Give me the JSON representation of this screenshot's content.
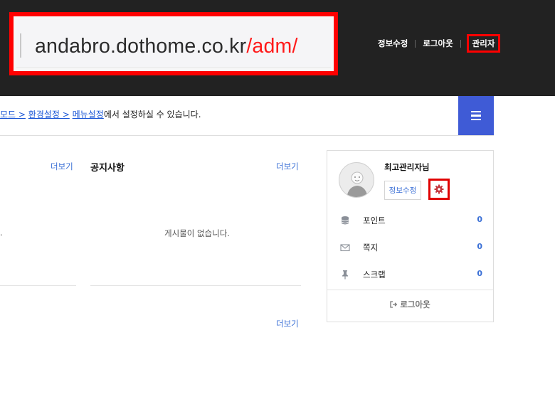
{
  "url_bar": {
    "domain": "andabro.dothome.co.kr",
    "path": "/adm/"
  },
  "top_nav": {
    "edit_info": "정보수정",
    "logout": "로그아웃",
    "admin": "관리자"
  },
  "info_line": {
    "link1": "모드 >",
    "link2": "환경설정 >",
    "link3": "메뉴설정",
    "suffix": "에서 설정하실 수 있습니다."
  },
  "boards": {
    "left_more": "더보기",
    "notice_title": "공지사항",
    "notice_more": "더보기",
    "notice_empty": "게시물이 없습니다.",
    "left_fragment": ".",
    "bottom_more": "더보기"
  },
  "profile": {
    "name": "최고관리자님",
    "edit_button": "정보수정",
    "stats": [
      {
        "label": "포인트",
        "value": "0",
        "icon": "database-icon"
      },
      {
        "label": "쪽지",
        "value": "0",
        "icon": "envelope-icon"
      },
      {
        "label": "스크랩",
        "value": "0",
        "icon": "pin-icon"
      }
    ],
    "logout": "로그아웃"
  },
  "colors": {
    "header_bg": "#222222",
    "accent_blue": "#3f5bd6",
    "link_blue": "#3b70d6",
    "highlight_red": "#ff0000"
  }
}
